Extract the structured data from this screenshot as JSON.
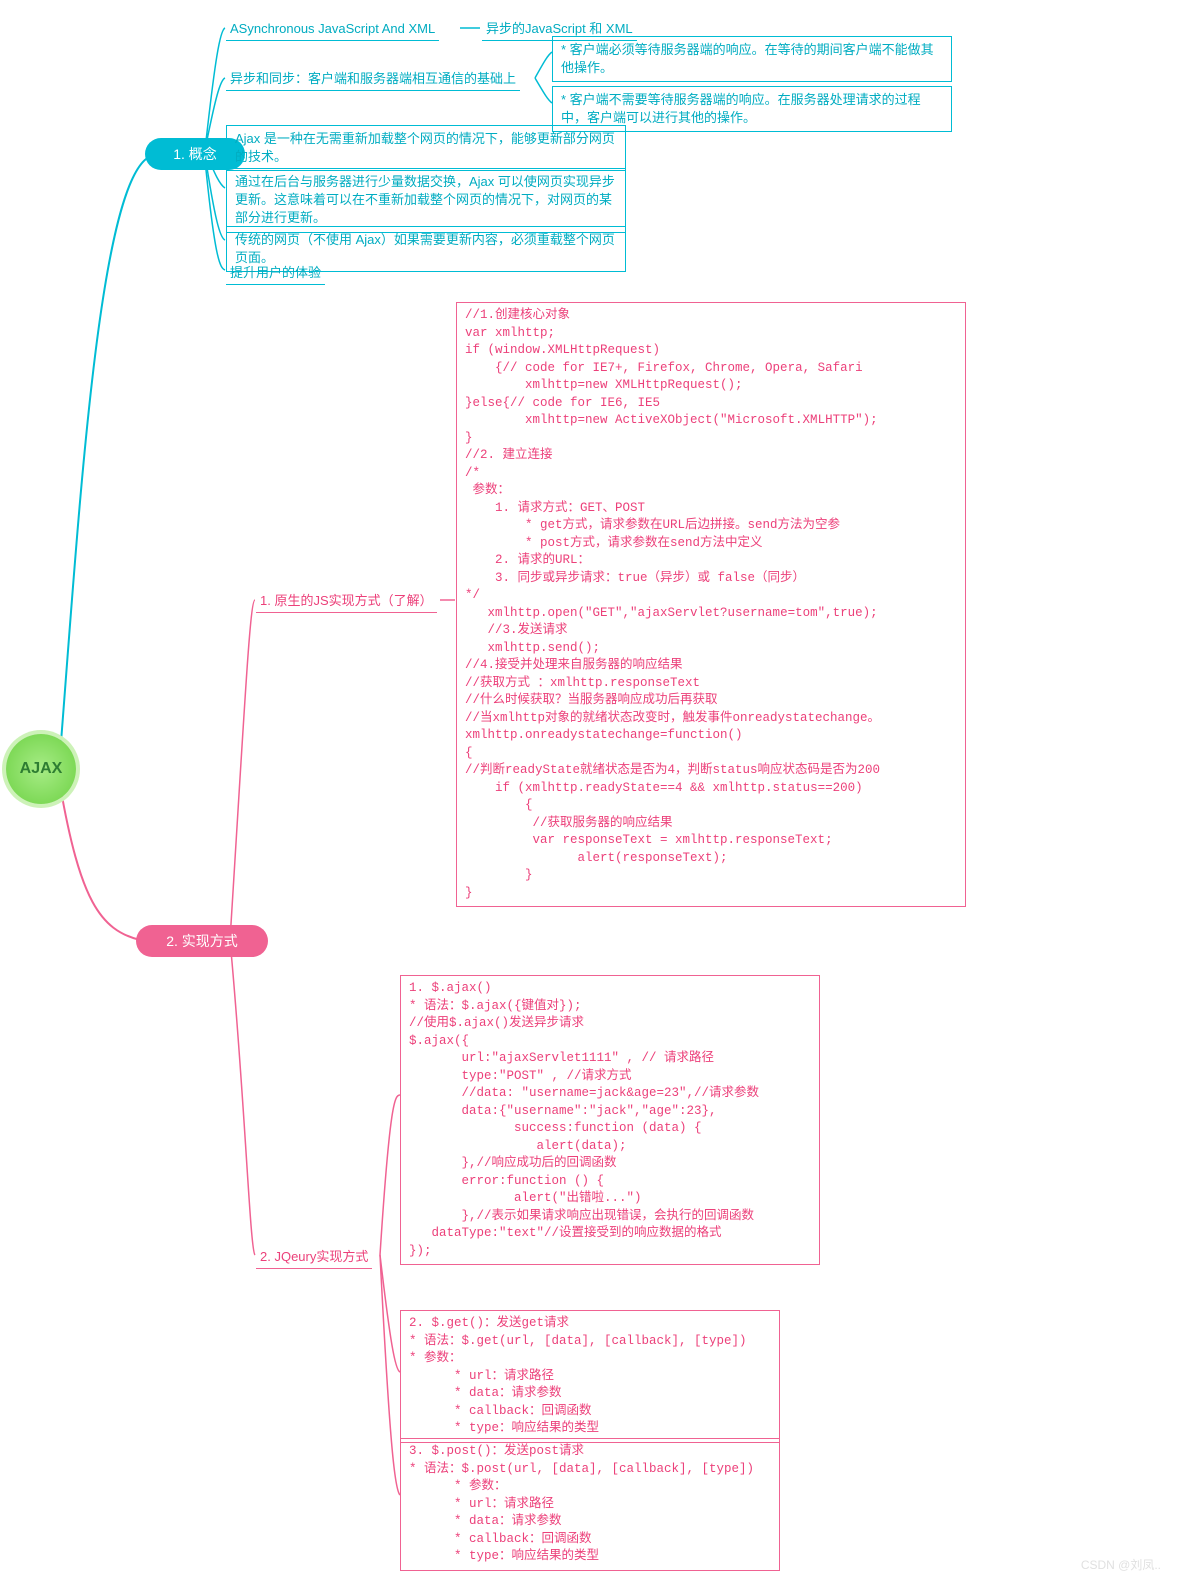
{
  "root": {
    "label": "AJAX"
  },
  "branch1": {
    "title": "1. 概念",
    "n1a": "ASynchronous JavaScript And XML",
    "n1b": "异步的JavaScript 和 XML",
    "n2": "异步和同步：客户端和服务器端相互通信的基础上",
    "n2a": "* 客户端必须等待服务器端的响应。在等待的期间客户端不能做其他操作。",
    "n2b": "* 客户端不需要等待服务器端的响应。在服务器处理请求的过程中，客户端可以进行其他的操作。",
    "n3": "Ajax 是一种在无需重新加载整个网页的情况下，能够更新部分网页的技术。",
    "n4": "通过在后台与服务器进行少量数据交换，Ajax 可以使网页实现异步更新。这意味着可以在不重新加载整个网页的情况下，对网页的某部分进行更新。",
    "n5": "传统的网页（不使用 Ajax）如果需要更新内容，必须重载整个网页页面。",
    "n6": "提升用户的体验"
  },
  "branch2": {
    "title": "2. 实现方式",
    "js_title": "1. 原生的JS实现方式（了解）",
    "js_code": "//1.创建核心对象\nvar xmlhttp;\nif (window.XMLHttpRequest)\n    {// code for IE7+, Firefox, Chrome, Opera, Safari\n        xmlhttp=new XMLHttpRequest();\n}else{// code for IE6, IE5\n        xmlhttp=new ActiveXObject(\"Microsoft.XMLHTTP\");\n}\n//2. 建立连接\n/*\n 参数：\n    1. 请求方式：GET、POST\n        * get方式，请求参数在URL后边拼接。send方法为空参\n        * post方式，请求参数在send方法中定义\n    2. 请求的URL：\n    3. 同步或异步请求：true（异步）或 false（同步）\n*/\n   xmlhttp.open(\"GET\",\"ajaxServlet?username=tom\",true);\n   //3.发送请求\n   xmlhttp.send();\n//4.接受并处理来自服务器的响应结果\n//获取方式 ：xmlhttp.responseText\n//什么时候获取？当服务器响应成功后再获取\n//当xmlhttp对象的就绪状态改变时，触发事件onreadystatechange。\nxmlhttp.onreadystatechange=function()\n{\n//判断readyState就绪状态是否为4，判断status响应状态码是否为200\n    if (xmlhttp.readyState==4 && xmlhttp.status==200)\n        {\n         //获取服务器的响应结果\n         var responseText = xmlhttp.responseText;\n               alert(responseText);\n        }\n}",
    "jq_title": "2. JQeury实现方式",
    "jq1": "1. $.ajax()\n* 语法：$.ajax({键值对});\n//使用$.ajax()发送异步请求\n$.ajax({\n       url:\"ajaxServlet1111\" , // 请求路径\n       type:\"POST\" , //请求方式\n       //data: \"username=jack&age=23\",//请求参数\n       data:{\"username\":\"jack\",\"age\":23},\n              success:function (data) {\n                 alert(data);\n       },//响应成功后的回调函数\n       error:function () {\n              alert(\"出错啦...\")\n       },//表示如果请求响应出现错误，会执行的回调函数\n   dataType:\"text\"//设置接受到的响应数据的格式\n});",
    "jq2": "2. $.get()：发送get请求\n* 语法：$.get(url, [data], [callback], [type])\n* 参数：\n      * url：请求路径\n      * data：请求参数\n      * callback：回调函数\n      * type：响应结果的类型",
    "jq3": "3. $.post()：发送post请求\n* 语法：$.post(url, [data], [callback], [type])\n      * 参数：\n      * url：请求路径\n      * data：请求参数\n      * callback：回调函数\n      * type：响应结果的类型"
  },
  "watermark": "CSDN @刘凤.."
}
